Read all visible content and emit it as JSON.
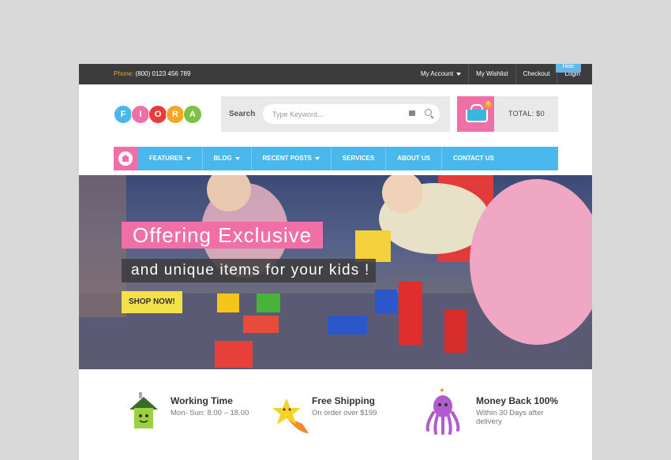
{
  "topbar": {
    "phone_label": "Phone:",
    "phone_number": "(800) 0123 456 789",
    "links": [
      "My Account",
      "My Wishlist",
      "Checkout",
      "Login"
    ],
    "hide_label": "Hide"
  },
  "logo": {
    "letters": [
      "F",
      "I",
      "O",
      "R",
      "A"
    ],
    "colors": [
      "#4ab8ec",
      "#f06fa6",
      "#e63c3c",
      "#f6a623",
      "#7cc242"
    ]
  },
  "search": {
    "label": "Search",
    "placeholder": "Type Keyword..."
  },
  "cart": {
    "count": "0",
    "total": "TOTAL: $0"
  },
  "nav": {
    "items": [
      "FEATURES",
      "BLOG",
      "RECENT POSTS",
      "SERVICES",
      "ABOUT US",
      "CONTACT US"
    ]
  },
  "hero": {
    "headline": "Offering Exclusive",
    "subline": "and unique items for your kids !",
    "cta": "SHOP NOW!"
  },
  "features": [
    {
      "title": "Working Time",
      "subtitle": "Mon- Sun: 8.00 – 18.00",
      "icon": "house-icon"
    },
    {
      "title": "Free Shipping",
      "subtitle": "On order over $199",
      "icon": "shooting-star-icon"
    },
    {
      "title": "Money Back 100%",
      "subtitle": "Within 30 Days after delivery",
      "icon": "octopus-icon"
    }
  ],
  "colors": {
    "accent_pink": "#f06fa6",
    "accent_blue": "#4ab8ec",
    "topbar": "#3c3c3c",
    "cta_yellow": "#f3e04b"
  }
}
